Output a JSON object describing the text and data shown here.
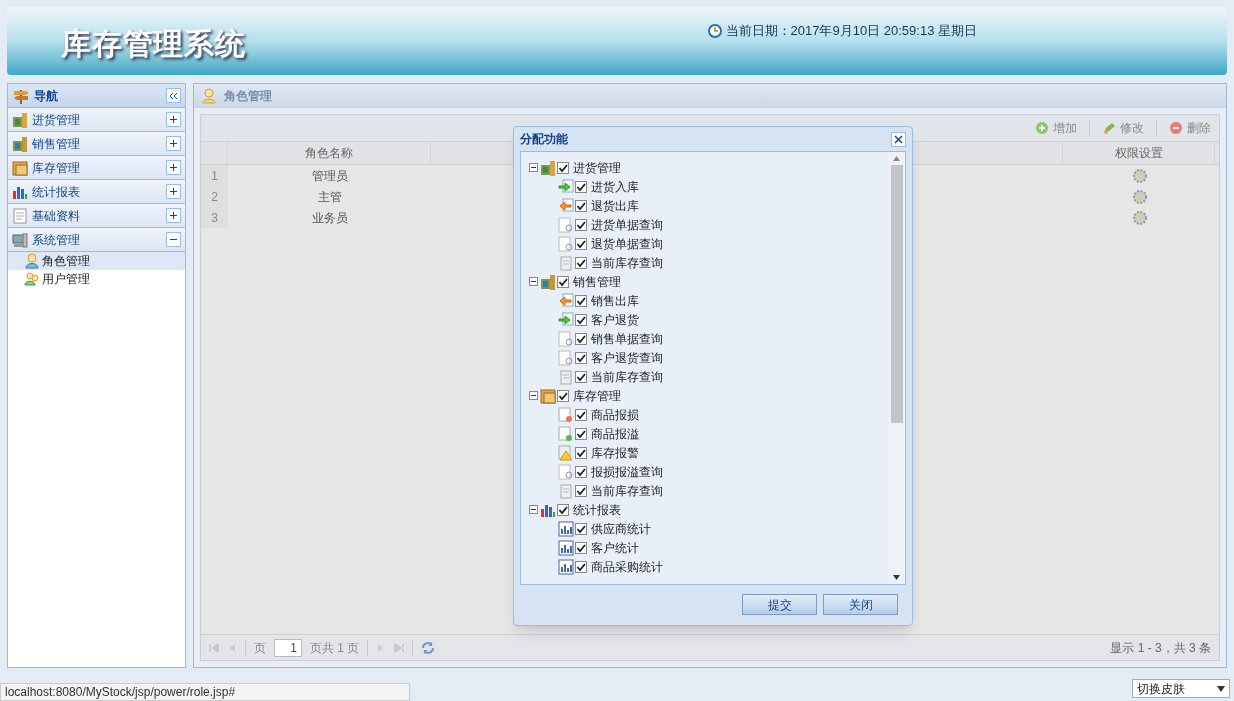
{
  "header": {
    "title": "库存管理系统",
    "date": "当前日期：2017年9月10日 20:59:13 星期日"
  },
  "nav": {
    "title": "导航",
    "sections": [
      {
        "label": "进货管理",
        "kind": "purchase",
        "expanded": false
      },
      {
        "label": "销售管理",
        "kind": "sale",
        "expanded": false
      },
      {
        "label": "库存管理",
        "kind": "stock",
        "expanded": false
      },
      {
        "label": "统计报表",
        "kind": "report",
        "expanded": false
      },
      {
        "label": "基础资料",
        "kind": "basic",
        "expanded": false
      },
      {
        "label": "系统管理",
        "kind": "system",
        "expanded": true,
        "children": [
          {
            "label": "角色管理",
            "kind": "role",
            "selected": true
          },
          {
            "label": "用户管理",
            "kind": "user",
            "selected": false
          }
        ]
      }
    ]
  },
  "panel": {
    "title": "角色管理"
  },
  "toolbar": [
    {
      "label": "增加",
      "kind": "add"
    },
    {
      "label": "修改",
      "kind": "edit"
    },
    {
      "label": "删除",
      "kind": "delete"
    }
  ],
  "table": {
    "columns": [
      "角色名称",
      "权限设置"
    ],
    "rows": [
      {
        "number": "1",
        "name": "管理员"
      },
      {
        "number": "2",
        "name": "主管"
      },
      {
        "number": "3",
        "name": "业务员"
      }
    ]
  },
  "pager": {
    "page_label": "页",
    "page": "1",
    "page_total": "页共 1 页",
    "summary": "显示 1 - 3，共 3 条"
  },
  "dialog": {
    "title": "分配功能",
    "tree": [
      {
        "label": "进货管理",
        "kind": "purchase",
        "expanded": true,
        "checked": true,
        "children": [
          {
            "label": "进货入库",
            "kind": "in",
            "checked": true
          },
          {
            "label": "退货出库",
            "kind": "out",
            "checked": true
          },
          {
            "label": "进货单据查询",
            "kind": "query",
            "checked": true
          },
          {
            "label": "退货单据查询",
            "kind": "query",
            "checked": true
          },
          {
            "label": "当前库存查询",
            "kind": "doc",
            "checked": true
          }
        ]
      },
      {
        "label": "销售管理",
        "kind": "sale",
        "expanded": true,
        "checked": true,
        "children": [
          {
            "label": "销售出库",
            "kind": "out",
            "checked": true
          },
          {
            "label": "客户退货",
            "kind": "in",
            "checked": true
          },
          {
            "label": "销售单据查询",
            "kind": "query",
            "checked": true
          },
          {
            "label": "客户退货查询",
            "kind": "query",
            "checked": true
          },
          {
            "label": "当前库存查询",
            "kind": "doc",
            "checked": true
          }
        ]
      },
      {
        "label": "库存管理",
        "kind": "stock",
        "expanded": true,
        "checked": true,
        "children": [
          {
            "label": "商品报损",
            "kind": "loss",
            "checked": true
          },
          {
            "label": "商品报溢",
            "kind": "overflow",
            "checked": true
          },
          {
            "label": "库存报警",
            "kind": "alarm",
            "checked": true
          },
          {
            "label": "报损报溢查询",
            "kind": "query",
            "checked": true
          },
          {
            "label": "当前库存查询",
            "kind": "doc",
            "checked": true
          }
        ]
      },
      {
        "label": "统计报表",
        "kind": "report",
        "expanded": true,
        "checked": true,
        "children": [
          {
            "label": "供应商统计",
            "kind": "chart",
            "checked": true
          },
          {
            "label": "客户统计",
            "kind": "chart",
            "checked": true
          },
          {
            "label": "商品采购统计",
            "kind": "chart",
            "checked": true
          }
        ]
      }
    ],
    "buttons": [
      "提交",
      "关闭"
    ]
  },
  "status_url": "localhost:8080/MyStock/jsp/power/role.jsp#",
  "skin_select": "切换皮肤"
}
